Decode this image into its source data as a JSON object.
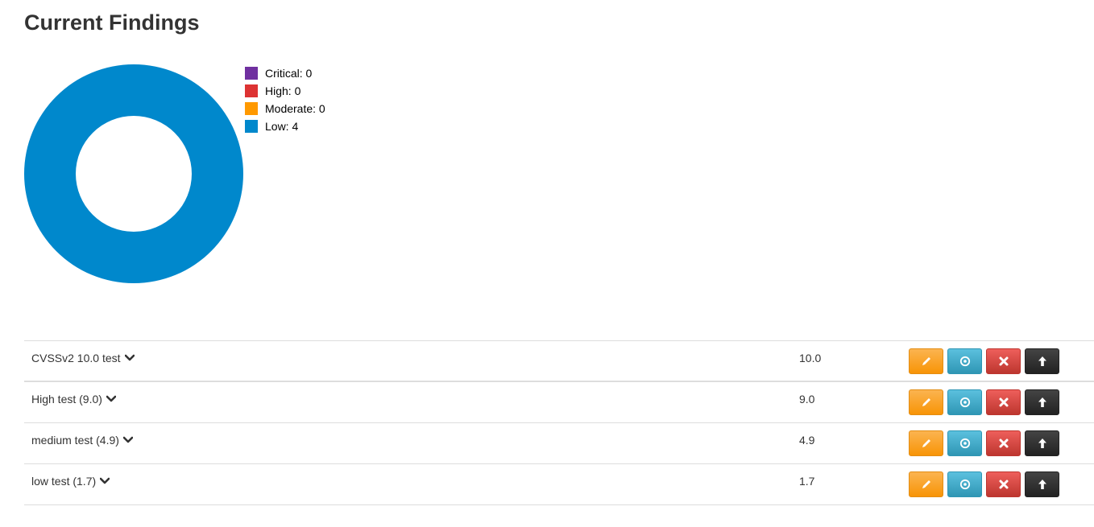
{
  "page": {
    "title": "Current Findings"
  },
  "chart_data": {
    "type": "pie",
    "variant": "donut",
    "categories": [
      "Critical",
      "High",
      "Moderate",
      "Low"
    ],
    "values": [
      0,
      0,
      0,
      4
    ],
    "colors": [
      "#7030a0",
      "#dd3333",
      "#ff9900",
      "#0088cc"
    ],
    "legend_placement": "right",
    "legend_labels": [
      "Critical: 0",
      "High: 0",
      "Moderate: 0",
      "Low: 4"
    ]
  },
  "findings": [
    {
      "title": "CVSSv2 10.0 test",
      "score": "10.0"
    },
    {
      "title": "High test (9.0)",
      "score": "9.0"
    },
    {
      "title": "medium test (4.9)",
      "score": "4.9"
    },
    {
      "title": "low test (1.7)",
      "score": "1.7"
    }
  ],
  "actions": {
    "edit_icon": "pencil-icon",
    "view_icon": "circle-target-icon",
    "delete_icon": "x-icon",
    "up_icon": "arrow-up-icon",
    "edit_color": "#f89406",
    "view_color": "#2f96b4",
    "delete_color": "#bd362f",
    "up_color": "#222222"
  }
}
